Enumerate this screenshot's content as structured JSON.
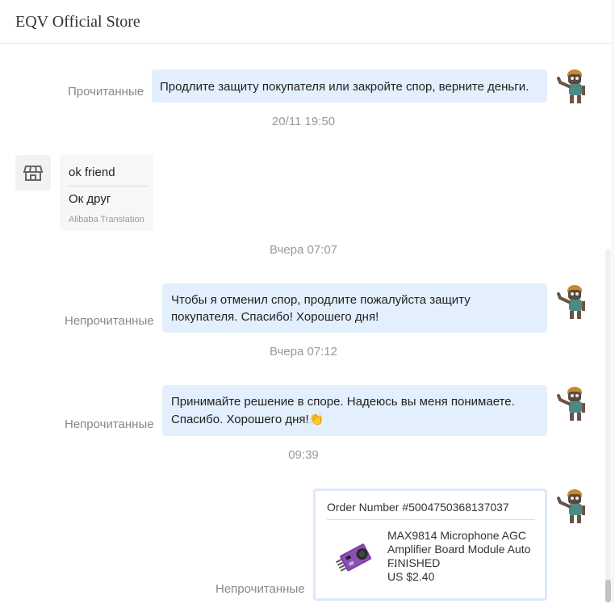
{
  "header": {
    "title": "EQV Official Store"
  },
  "messages": [
    {
      "status": "Прочитанные",
      "text": "Продлите защиту покупателя или закройте спор, верните деньги."
    },
    {
      "status": "Непрочитанные",
      "text": "Чтобы я отменил спор, продлите пожалуйста защиту покупателя. Спасибо! Хорошего дня!"
    },
    {
      "status": "Непрочитанные",
      "text": "Принимайте решение в споре. Надеюсь вы меня понимаете. Спасибо. Хорошего дня!👏"
    },
    {
      "status": "Непрочитанные"
    }
  ],
  "timestamps": [
    "20/11 19:50",
    "Вчера 07:07",
    "Вчера 07:12",
    "09:39"
  ],
  "incoming": {
    "original": "ok friend",
    "translation": "Ок друг",
    "provider": "Alibaba Translation"
  },
  "order": {
    "number": "Order Number #5004750368137037",
    "product_name": "MAX9814 Microphone AGC Amplifier Board Module Auto ...",
    "status": "FINISHED",
    "price": "US $2.40"
  },
  "icons": {
    "store_avatar": "store-icon",
    "user_avatar": "robot-avatar-icon",
    "product_image": "microphone-module-image"
  }
}
